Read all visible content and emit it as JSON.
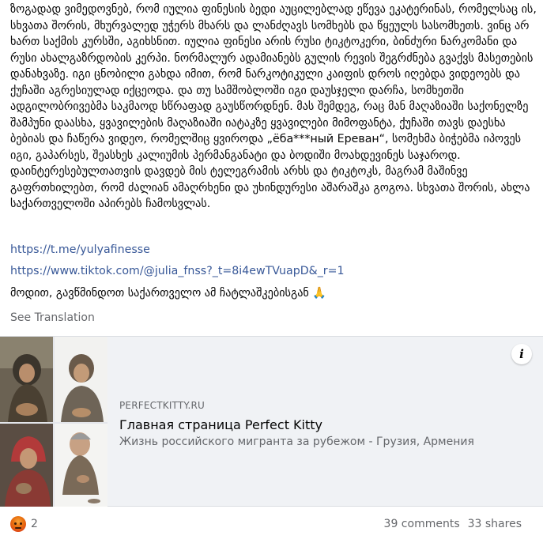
{
  "post": {
    "text": "ზოგადად ვიმედოვნებ, რომ იულია ფინესის ბედი აუცილებლად ეწევა ეკატერინას, რომელსაც ის, სხვათა შორის, მხურვალედ უჭერს მხარს და ლანძღავს სომხებს და წყეულს სასომხეთს. ვინც არ ხართ საქმის კურსში, აგიხსნით. იულია ფინესი არის რუსი ტიკტოკერი, ბინძური ნარკომანი და რუსი ახალგაზრდობის კერპი. ნორმალურ ადამიანებს გულის რევის შეგრძნება გვაქვს მასეთების დანახვაზე. იგი ცნობილი გახდა იმით, რომ ნარკოტიკული კაიფის დროს იღებდა ვიდეოებს და ქუჩაში აგრესიულად იქცეოდა. და თუ სამშობლოში იგი დაუსჯელი დარჩა, სომხეთში ადგილობრივებმა საკმაოდ სწრაფად გაუსწორდნენ. მას შემდეგ, რაც მან მაღაზიაში საქონელზე შამპუნი დაასხა, ყვავილების მაღაზიაში იატაკზე ყვავილები მიმოფანტა, ქუჩაში თავს დაესხა ბებიას და ჩაწერა ვიდეო, რომელშიც ყვიროდა „ёба***ный Ереван“, სომეხმა ბიჭებმა იპოვეს იგი, გაპარსეს, შეასხეს კალიუმის პერმანგანატი და ბოდიში მოახდევინეს საჯაროდ. დაინტერესებულთათვის დავდებ მის ტელეგრამის არხს და ტიკტოკს, მაგრამ მაშინვე გაფრთხილებთ, რომ ძალიან ამაღრხენი და უხინდურესი აშარაშკა გოგოა. სხვათა შორის, ახლა საქართველოში აპირებს ჩამოსვლას.",
    "links": [
      "https://t.me/yulyafinesse",
      "https://www.tiktok.com/@julia_fnss?_t=8i4ewTVuapD&_r=1"
    ],
    "closing": "მოდით, გავწმინდოთ საქართველო ამ ჩატლაშკებისგან 🙏",
    "see_translation": "See Translation"
  },
  "link_preview": {
    "domain": "PERFECTKITTY.RU",
    "title": "Главная страница Perfect Kitty",
    "description": "Жизнь российского мигранта за рубежом - Грузия, Армения",
    "info_icon": "info-icon",
    "thumbnails": [
      "beggar-thumbnail-1",
      "beggar-thumbnail-2",
      "beggar-thumbnail-3",
      "beggar-thumbnail-4"
    ]
  },
  "footer": {
    "reaction_icon": "angry-reaction-icon",
    "reaction_count": "2",
    "comments": "39 comments",
    "shares": "33 shares"
  },
  "colors": {
    "link": "#385898",
    "muted": "#65676b",
    "preview_bg": "#f0f2f5"
  }
}
